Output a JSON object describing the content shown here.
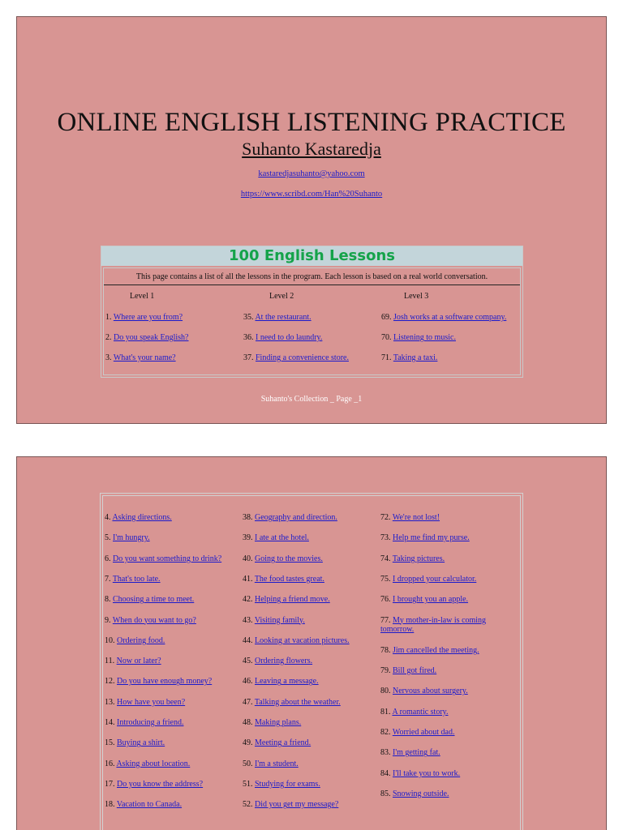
{
  "page1": {
    "title": "ONLINE ENGLISH LISTENING PRACTICE",
    "author": "Suhanto Kastaredja",
    "email": "kastaredjasuhanto@yahoo.com",
    "website": "https://www.scribd.com/Han%20Suhanto",
    "lessons_header": "100 English Lessons",
    "intro": "This page contains a list of all the lessons in the program. Each lesson is based on a real world conversation.",
    "levels": [
      "Level 1",
      "Level 2",
      "Level 3"
    ],
    "columns": [
      [
        {
          "num": "1.",
          "text": "Where are you from?"
        },
        {
          "num": "2.",
          "text": "Do you speak English?"
        },
        {
          "num": "3.",
          "text": "What's your name?"
        }
      ],
      [
        {
          "num": "35.",
          "text": "At the restaurant."
        },
        {
          "num": "36.",
          "text": "I need to do laundry."
        },
        {
          "num": "37.",
          "text": "Finding a convenience store."
        }
      ],
      [
        {
          "num": "69.",
          "text": "Josh works at a software company."
        },
        {
          "num": "70.",
          "text": "Listening to music."
        },
        {
          "num": "71.",
          "text": "Taking a taxi."
        }
      ]
    ],
    "footer": "Suhanto's Collection _ Page _1"
  },
  "page2": {
    "columns": [
      [
        {
          "num": "4.",
          "text": "Asking directions."
        },
        {
          "num": "5.",
          "text": "I'm hungry."
        },
        {
          "num": "6.",
          "text": "Do you want something to drink?"
        },
        {
          "num": "7.",
          "text": "That's too late."
        },
        {
          "num": "8.",
          "text": "Choosing a time to meet."
        },
        {
          "num": "9.",
          "text": "When do you want to go?"
        },
        {
          "num": "10.",
          "text": "Ordering food."
        },
        {
          "num": "11.",
          "text": "Now or later?"
        },
        {
          "num": "12.",
          "text": "Do you have enough money?"
        },
        {
          "num": "13.",
          "text": "How have you been?"
        },
        {
          "num": "14.",
          "text": "Introducing a friend."
        },
        {
          "num": "15.",
          "text": "Buying a shirt."
        },
        {
          "num": "16.",
          "text": "Asking about location."
        },
        {
          "num": "17.",
          "text": "Do you know the address?"
        },
        {
          "num": "18.",
          "text": "Vacation to Canada."
        }
      ],
      [
        {
          "num": "38.",
          "text": "Geography and direction."
        },
        {
          "num": "39.",
          "text": "I ate at the hotel."
        },
        {
          "num": "40.",
          "text": "Going to the movies."
        },
        {
          "num": "41.",
          "text": "The food tastes great."
        },
        {
          "num": "42.",
          "text": "Helping a friend move."
        },
        {
          "num": "43.",
          "text": "Visiting family."
        },
        {
          "num": "44.",
          "text": "Looking at vacation pictures."
        },
        {
          "num": "45.",
          "text": "Ordering flowers."
        },
        {
          "num": "46.",
          "text": "Leaving a message."
        },
        {
          "num": "47.",
          "text": "Talking about the weather."
        },
        {
          "num": "48.",
          "text": "Making plans."
        },
        {
          "num": "49.",
          "text": "Meeting a friend."
        },
        {
          "num": "50.",
          "text": "I'm a student."
        },
        {
          "num": "51.",
          "text": "Studying for exams."
        },
        {
          "num": "52.",
          "text": "Did you get my message?"
        }
      ],
      [
        {
          "num": "72.",
          "text": "We're not lost!"
        },
        {
          "num": "73.",
          "text": "Help me find my purse."
        },
        {
          "num": "74.",
          "text": "Taking pictures."
        },
        {
          "num": "75.",
          "text": "I dropped your calculator."
        },
        {
          "num": "76.",
          "text": "I brought you an apple."
        },
        {
          "num": "77.",
          "text": "My mother-in-law is coming tomorrow."
        },
        {
          "num": "78.",
          "text": "Jim cancelled the meeting."
        },
        {
          "num": "79.",
          "text": "Bill got fired."
        },
        {
          "num": "80.",
          "text": "Nervous about surgery."
        },
        {
          "num": "81.",
          "text": "A romantic story."
        },
        {
          "num": "82.",
          "text": "Worried about dad."
        },
        {
          "num": "83.",
          "text": "I'm getting fat."
        },
        {
          "num": "84.",
          "text": "I'll take you to work."
        },
        {
          "num": "85.",
          "text": "Snowing outside."
        }
      ]
    ]
  },
  "colors": {
    "page_background": "#d89593",
    "header_band": "#c3d5da",
    "header_text": "#15a34a",
    "link": "#1a1acc"
  }
}
